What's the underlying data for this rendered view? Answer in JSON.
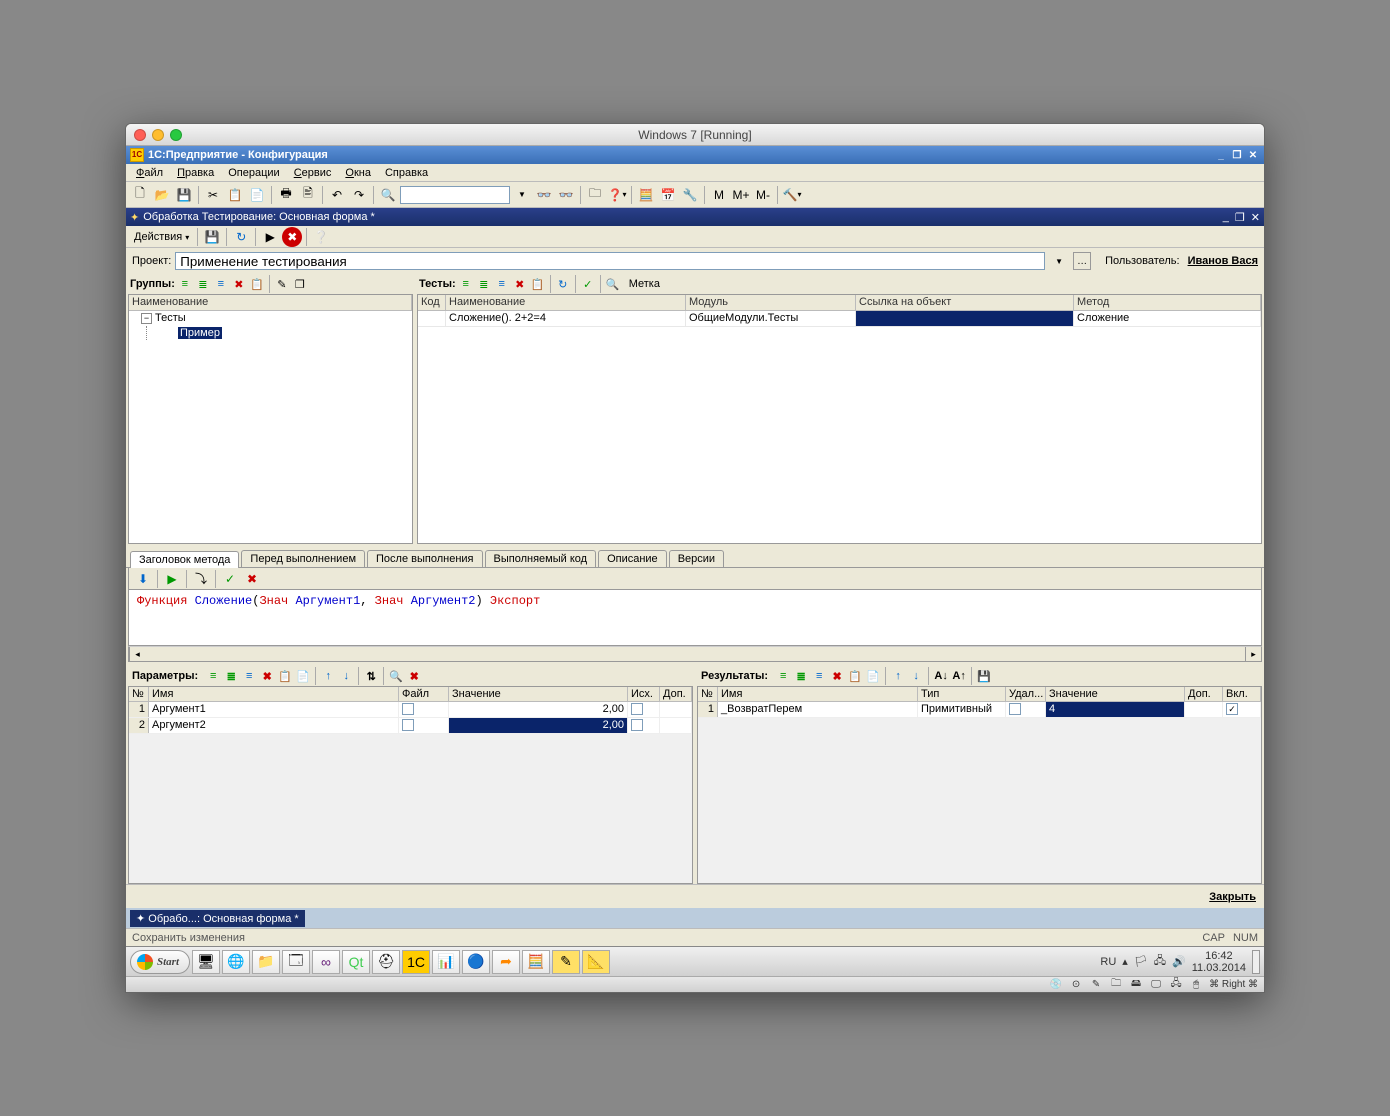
{
  "mac": {
    "title": "Windows 7 [Running]",
    "right": "⌘ Right ⌘"
  },
  "app": {
    "title": "1С:Предприятие - Конфигурация"
  },
  "menu": {
    "file": "Файл",
    "edit": "Правка",
    "ops": "Операции",
    "service": "Сервис",
    "windows": "Окна",
    "help": "Справка"
  },
  "doc": {
    "title": "Обработка Тестирование: Основная форма *",
    "actions": "Действия"
  },
  "project": {
    "label": "Проект:",
    "value": "Применение тестирования",
    "userlabel": "Пользователь:",
    "user": "Иванов Вася"
  },
  "groups": {
    "label": "Группы:",
    "col": "Наименование",
    "root": "Тесты",
    "child": "Пример"
  },
  "tests": {
    "label": "Тесты:",
    "mark": "Метка",
    "cols": {
      "code": "Код",
      "name": "Наименование",
      "module": "Модуль",
      "ref": "Ссылка на объект",
      "method": "Метод"
    },
    "row": {
      "name": "Сложение(). 2+2=4",
      "module": "ОбщиеМодули.Тесты",
      "method": "Сложение"
    }
  },
  "tabs": {
    "t1": "Заголовок метода",
    "t2": "Перед выполнением",
    "t3": "После выполнения",
    "t4": "Выполняемый код",
    "t5": "Описание",
    "t6": "Версии"
  },
  "code": {
    "kw1": "Функция",
    "id1": "Сложение",
    "lp": "(",
    "kw2": "Знач",
    "a1": "Аргумент1",
    "comma": ",",
    "kw3": "Знач",
    "a2": "Аргумент2",
    "rp": ")",
    "kw4": "Экспорт"
  },
  "params": {
    "label": "Параметры:",
    "cols": {
      "n": "№",
      "name": "Имя",
      "file": "Файл",
      "value": "Значение",
      "src": "Исх.",
      "ext": "Доп."
    },
    "rows": [
      {
        "n": "1",
        "name": "Аргумент1",
        "value": "2,00"
      },
      {
        "n": "2",
        "name": "Аргумент2",
        "value": "2,00"
      }
    ]
  },
  "results": {
    "label": "Результаты:",
    "cols": {
      "n": "№",
      "name": "Имя",
      "type": "Тип",
      "del": "Удал...",
      "value": "Значение",
      "ext": "Доп.",
      "on": "Вкл."
    },
    "rows": [
      {
        "n": "1",
        "name": "_ВозвратПерем",
        "type": "Примитивный",
        "value": "4",
        "on": true
      }
    ]
  },
  "close": "Закрыть",
  "doctab": "Обрабо...: Основная форма *",
  "status": {
    "msg": "Сохранить изменения",
    "cap": "CAP",
    "num": "NUM"
  },
  "taskbar": {
    "start": "Start",
    "lang": "RU",
    "time": "16:42",
    "date": "11.03.2014"
  }
}
